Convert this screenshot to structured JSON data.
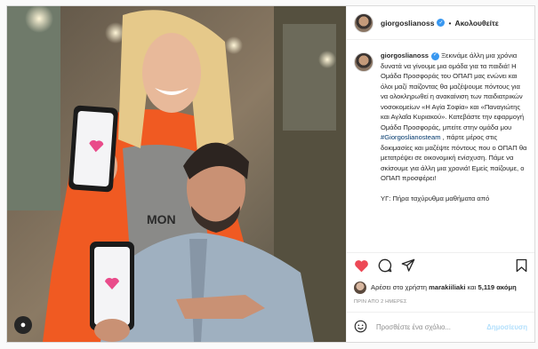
{
  "header": {
    "username": "giorgoslianoss",
    "separator": "•",
    "follow_label": "Ακολουθείτε"
  },
  "caption": {
    "username": "giorgoslianoss",
    "part1": " Ξεκινάμε άλλη μια χρόνια δυνατά να γίνουμε μια ομάδα για τα παιδιά! Η Ομάδα Προσφοράς του ΟΠΑΠ μας ενώνει και όλοι μαζί παίζοντας θα μαζέψουμε πόντους για να ολοκληρωθεί η ανακαίνιση των παιδιατρικών νοσοκομείων «Η Αγία Σοφία» και «Παναγιώτης και Αγλαΐα Κυριακού». Κατεβάστε την εφαρμογή Ομάδα Προσφοράς, μπείτε στην ομάδα μου ",
    "hashtag": "#Giorgoslianosteam",
    "part2": " , πάρτε μέρος στις δοκιμασίες και μαζέψτε πόντους που ο ΟΠΑΠ θα μετατρέψει σε οικονομική ενίσχυση. Πάμε να σκίσουμε για άλλη μια χρονιά! Εμείς παίζουμε, ο ΟΠΑΠ προσφέρει!",
    "ps": "ΥΓ: Πήρα ταχύρυθμα μαθήματα από"
  },
  "likes": {
    "prefix": "Αρέσει στο χρήστη ",
    "user": "marakiiliaki",
    "middle": " και ",
    "count": "5,119 ακόμη"
  },
  "timestamp": "ΠΡΙΝ ΑΠΟ 2 ΗΜΕΡΕΣ",
  "comment_box": {
    "placeholder": "Προσθέστε ένα σχόλιο...",
    "post_label": "Δημοσίευση"
  },
  "colors": {
    "like_red": "#ed4956",
    "link_blue": "#00376b",
    "verified_blue": "#3897f0",
    "post_disabled": "#b2dffc"
  },
  "icons": [
    "heart-icon",
    "comment-icon",
    "share-icon",
    "bookmark-icon",
    "emoji-icon",
    "user-tag-icon",
    "verified-icon"
  ]
}
